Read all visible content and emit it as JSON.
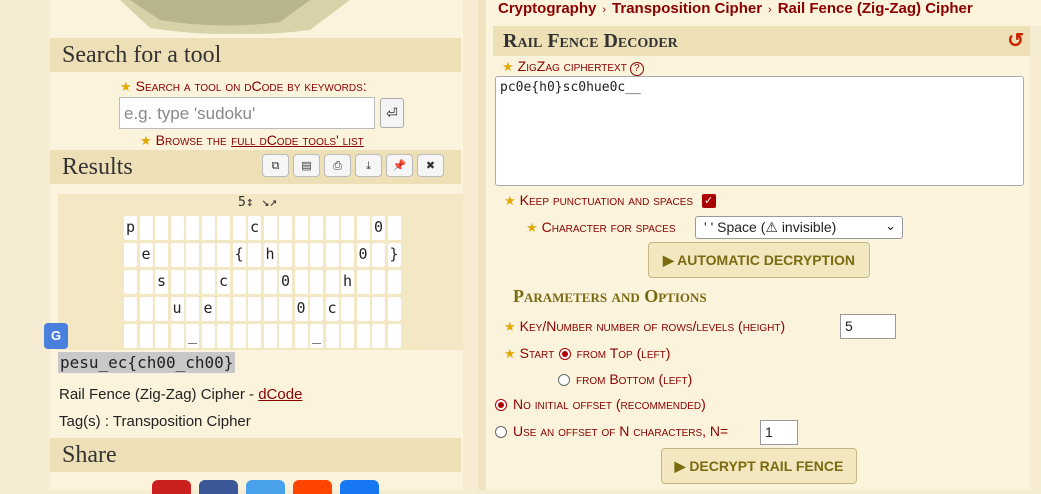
{
  "search": {
    "heading": "Search for a tool",
    "label": "Search a tool on dCode by keywords:",
    "placeholder": "e.g. type 'sudoku'",
    "go_icon": "⏎",
    "browse_prefix": "Browse the",
    "browse_link": "full dCode tools' list"
  },
  "results": {
    "heading": "Results",
    "toolbar_icons": [
      "copy-icon",
      "archive-icon",
      "print-icon",
      "download-icon",
      "pin-icon",
      "close-icon"
    ],
    "toolbar_glyphs": [
      "⧉",
      "▤",
      "⎙",
      "⤓",
      "📌",
      "✖"
    ],
    "rail_header": "5↕ ↘↗",
    "rails": [
      {
        "col": 4,
        "char": "p"
      },
      {
        "col": 12,
        "char": "c"
      },
      {
        "col": 20,
        "char": "0"
      },
      {
        "col": 5,
        "char": "e"
      },
      {
        "col": 11,
        "char": "{"
      },
      {
        "col": 13,
        "char": "h"
      },
      {
        "col": 19,
        "char": "0"
      },
      {
        "col": 21,
        "char": "}"
      },
      {
        "col": 6,
        "char": "s"
      },
      {
        "col": 10,
        "char": "c"
      },
      {
        "col": 14,
        "char": "0"
      },
      {
        "col": 18,
        "char": "h"
      },
      {
        "col": 7,
        "char": "u"
      },
      {
        "col": 9,
        "char": "e"
      },
      {
        "col": 15,
        "char": "0"
      },
      {
        "col": 17,
        "char": "c"
      },
      {
        "col": 8,
        "char": "_"
      },
      {
        "col": 16,
        "char": "_"
      }
    ],
    "plaintext": "pesu_ec{ch00_ch00}",
    "cipher_name": "Rail Fence (Zig-Zag) Cipher - ",
    "cipher_link": "dCode",
    "tags_label": "Tag(s) : Transposition Cipher"
  },
  "share": {
    "heading": "Share",
    "colors": [
      "#cc1f1f",
      "#3b5998",
      "#49a1eb",
      "#ff4500",
      "#1877f2"
    ]
  },
  "breadcrumb": [
    "Cryptography",
    "Transposition Cipher",
    "Rail Fence (Zig-Zag) Cipher"
  ],
  "decoder": {
    "title": "Rail Fence Decoder",
    "ciphertext_label": "ZigZag ciphertext",
    "ciphertext_value": "pc0e{h0}sc0hue0c__",
    "keep_punct_label": "Keep punctuation and spaces",
    "char_spaces_label": "Character for spaces",
    "char_spaces_value": "' ' Space (⚠ invisible)",
    "auto_button": "▶ AUTOMATIC DECRYPTION",
    "params_heading": "Parameters and Options",
    "key_label": "Key/Number number of rows/levels (height)",
    "key_value": "5",
    "start_label": "Start",
    "start_top": "from Top (left)",
    "start_bottom": "from Bottom (left)",
    "no_offset": "No initial offset (recommended)",
    "use_offset": "Use an offset of N characters, N=",
    "offset_value": "1",
    "decrypt_button": "▶ DECRYPT RAIL FENCE"
  }
}
